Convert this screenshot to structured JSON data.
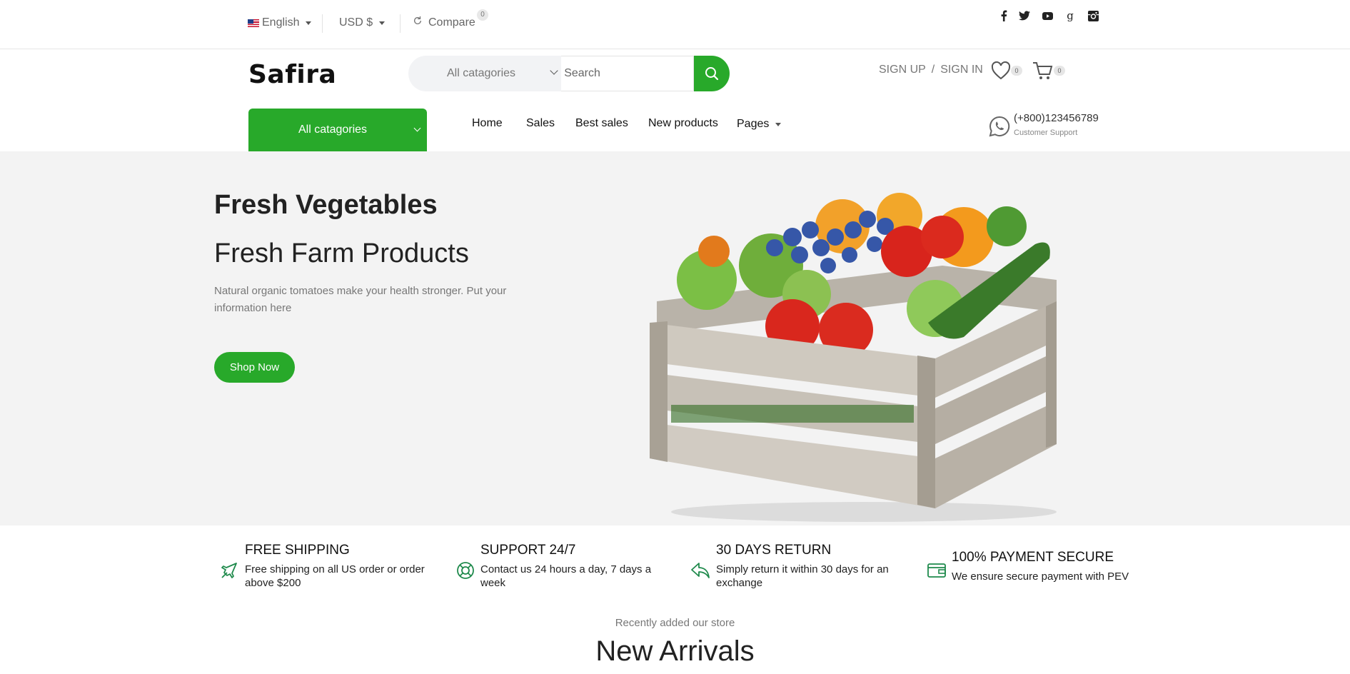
{
  "topbar": {
    "language": "English",
    "currency": "USD $",
    "compare_label": "Compare",
    "compare_count": "0",
    "social": [
      "facebook-icon",
      "twitter-icon",
      "youtube-icon",
      "google-icon",
      "instagram-icon"
    ]
  },
  "header": {
    "logo": "Safira",
    "search": {
      "category": "All catagories",
      "placeholder": "Search"
    },
    "auth": {
      "signup": "SIGN UP",
      "separator": "/",
      "signin": "SIGN IN"
    },
    "wishlist_count": "0",
    "cart_count": "0"
  },
  "nav": {
    "categories_button": "All catagories",
    "items": [
      "Home",
      "Sales",
      "Best sales",
      "New products",
      "Pages"
    ],
    "phone": "(+800)123456789",
    "phone_label": "Customer Support"
  },
  "hero": {
    "title": "Fresh Vegetables",
    "subtitle": "Fresh Farm Products",
    "description": "Natural organic tomatoes make your health stronger. Put your information here",
    "cta": "Shop Now"
  },
  "features": [
    {
      "title": "FREE SHIPPING",
      "desc": "Free shipping on all US order or order above $200",
      "icon": "plane-icon"
    },
    {
      "title": "SUPPORT 24/7",
      "desc": "Contact us 24 hours a day, 7 days a week",
      "icon": "lifebuoy-icon"
    },
    {
      "title": "30 DAYS RETURN",
      "desc": "Simply return it within 30 days for an exchange",
      "icon": "return-icon"
    },
    {
      "title": "100% PAYMENT SECURE",
      "desc": "We ensure secure payment with PEV",
      "icon": "wallet-icon"
    }
  ],
  "section": {
    "eyebrow": "Recently added our store",
    "title": "New Arrivals"
  },
  "colors": {
    "accent": "#28a92a",
    "hero_bg": "#f3f3f3"
  }
}
